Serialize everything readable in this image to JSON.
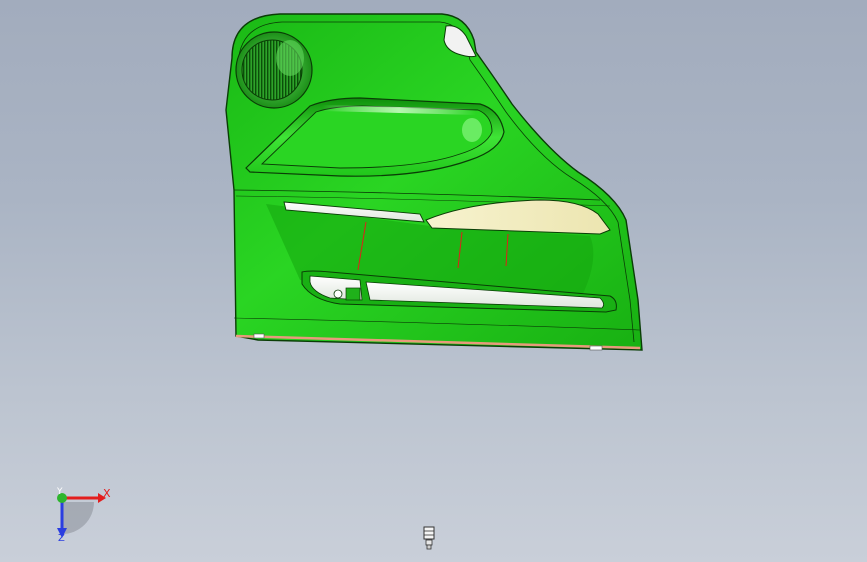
{
  "viewport": {
    "background_top": "#a2acbd",
    "background_bottom": "#c9cfd9"
  },
  "part": {
    "name": "door-trim-panel",
    "body_color": "#22c91c",
    "insert_color": "#f4efc2",
    "edge_color": "#0a3d06",
    "split_line_color": "#e0201a",
    "bottom_edge_color": "#e89a7c"
  },
  "triad": {
    "x_label": "X",
    "y_label": "Y",
    "z_label": "Z",
    "x_color": "#e31d1d",
    "y_color": "#2db52d",
    "z_color": "#2a3ee0"
  },
  "status_icon": "standard-views-icon"
}
